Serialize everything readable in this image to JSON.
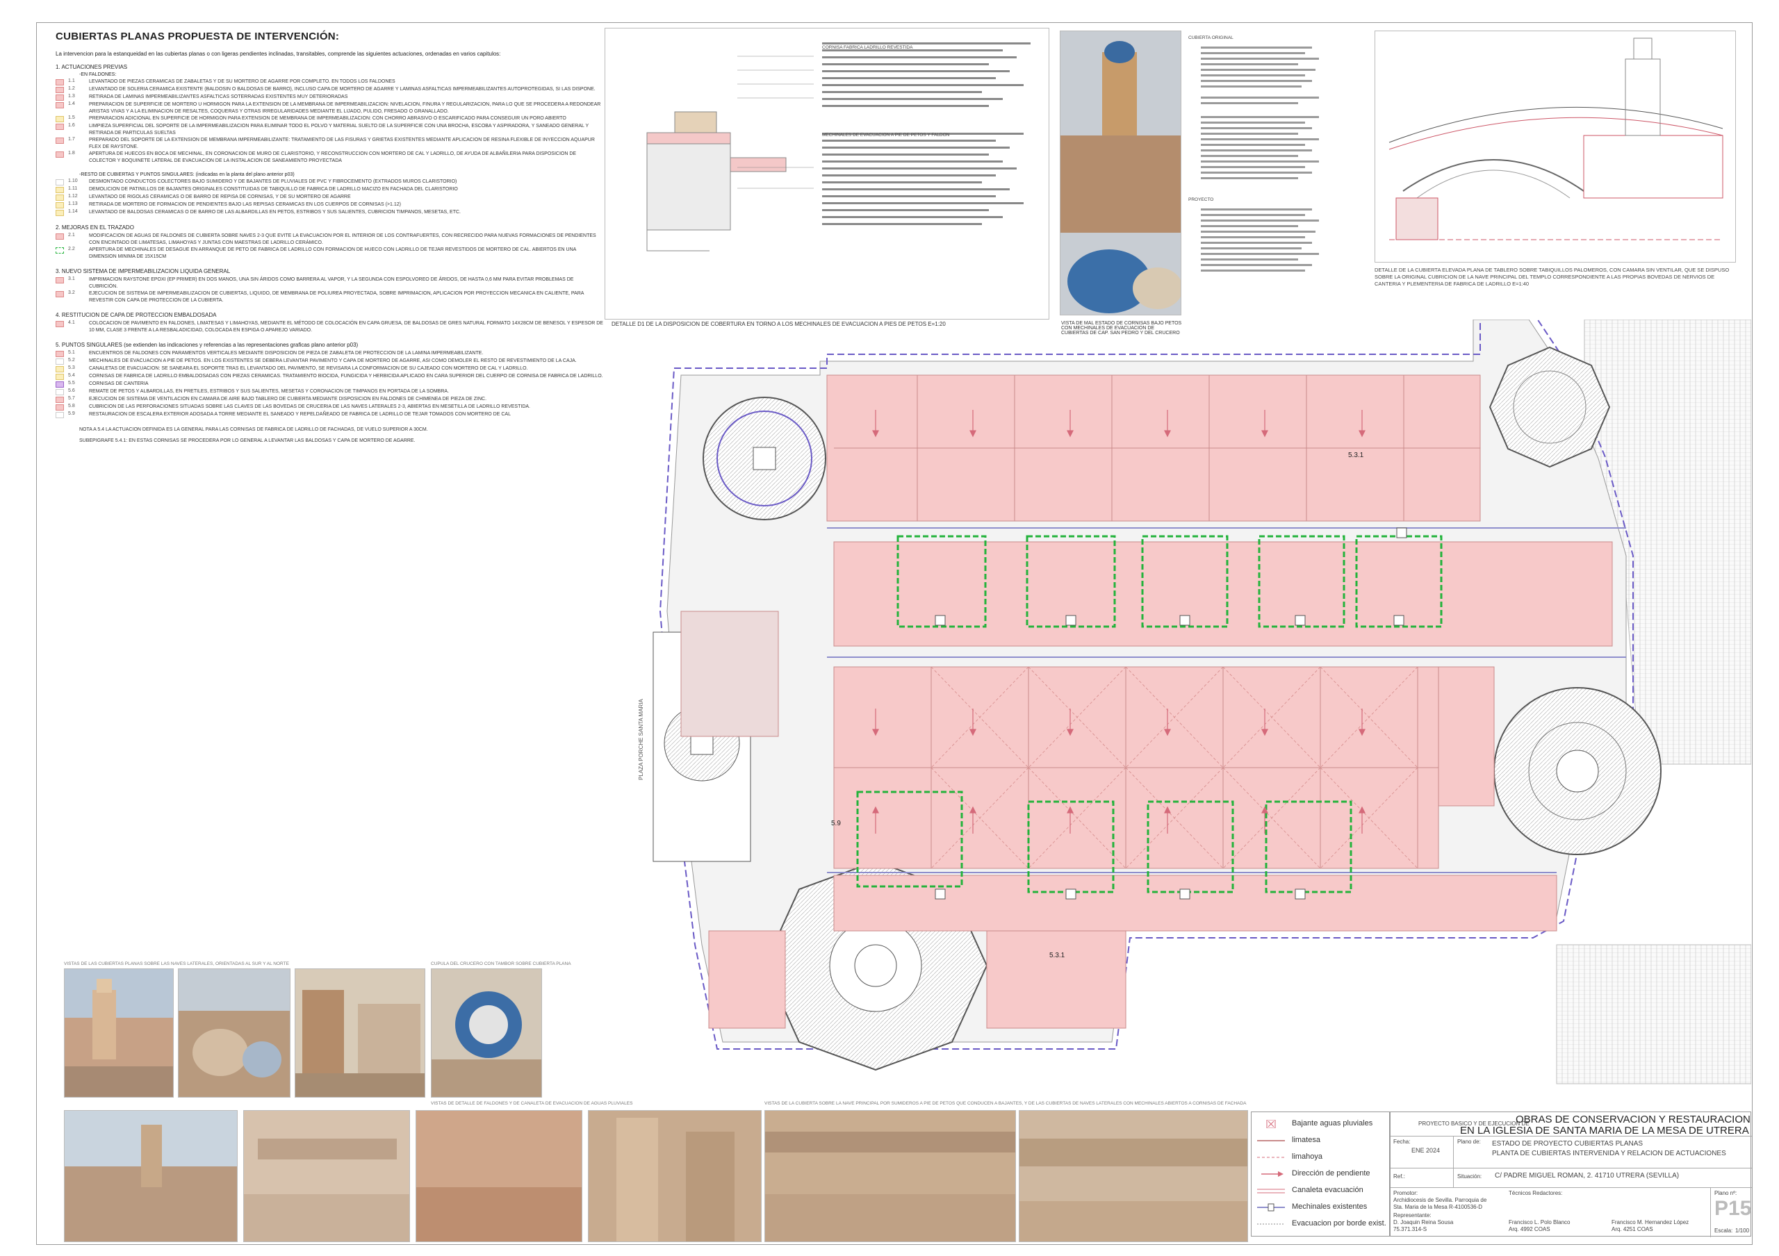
{
  "header": {
    "title": "CUBIERTAS PLANAS   PROPUESTA DE INTERVENCIÓN:",
    "intro": "La intervencion para la estanqueidad en las cubiertas planas o con ligeras pendientes inclinadas, transitables, comprende las siguientes actuaciones, ordenadas en varios capitulos:"
  },
  "sections": [
    {
      "heading": "1.    ACTUACIONES PREVIAS",
      "subheading": "-EN FALDONES:",
      "items": [
        {
          "code": "1.1",
          "swatch": "pink",
          "text": "LEVANTADO DE PIEZAS CERAMICAS DE ZABALETAS Y DE SU MORTERO DE AGARRE POR COMPLETO. EN TODOS LOS FALDONES"
        },
        {
          "code": "1.2",
          "swatch": "pink",
          "text": "LEVANTADO DE SOLERIA CERAMICA EXISTENTE (BALDOSIN O BALDOSAS DE BARRO), INCLUSO CAPA DE MORTERO DE AGARRE Y LAMINAS ASFALTICAS IMPERMEABILIZANTES AUTOPROTEGIDAS, SI LAS DISPONE."
        },
        {
          "code": "1.3",
          "swatch": "pink",
          "text": "RETIRADA DE LAMINAS IMPERMEABILIZANTES ASFALTICAS SOTERRADAS EXISTENTES MUY DETERIORADAS"
        },
        {
          "code": "1.4",
          "swatch": "pink",
          "text": "PREPARACION DE SUPERFICIE DE MORTERO U HORMIGON PARA LA EXTENSION DE LA MEMBRANA DE IMPERMEABILIZACION: NIVELACION, FINURA Y REGULARIZACION, PARA LO QUE SE PROCEDERA A REDONDEAR ARISTAS VIVAS Y A LA ELIMINACION DE RESALTES, COQUERAS Y OTRAS IRREGULARIDADES MEDIANTE EL LIJADO, PULIDO, FRESADO O GRANALLADO."
        },
        {
          "code": "1.5",
          "swatch": "yellow",
          "text": "PREPARACION ADICIONAL EN SUPERFICIE DE HORMIGON PARA EXTENSION DE MEMBRANA DE IMPERMEABILIZACION: CON CHORRO ABRASIVO O ESCARIFICADO PARA CONSEGUIR UN PORO ABIERTO"
        },
        {
          "code": "1.6",
          "swatch": "pink",
          "text": "LIMPIEZA SUPERFICIAL DEL SOPORTE DE LA IMPERMEABILIZACION PARA ELIMINAR TODO EL POLVO Y MATERIAL SUELTO DE LA SUPERFICIE CON UNA BROCHA, ESCOBA Y ASPIRADORA, Y SANEADO GENERAL Y RETIRADA DE PARTICULAS SUELTAS"
        },
        {
          "code": "1.7",
          "swatch": "pink",
          "text": "PREPARADO DEL SOPORTE DE LA EXTENSION DE MEMBRANA IMPERMEABILIZANTE: TRATAMIENTO DE LAS FISURAS Y GRIETAS EXISTENTES MEDIANTE APLICACION DE RESINA FLEXIBLE DE INYECCION AQUAPUR FLEX DE RAYSTONE."
        },
        {
          "code": "1.8",
          "swatch": "pink",
          "text": "APERTURA DE HUECOS EN BOCA DE MECHINAL, EN CORONACION DE MURO DE CLARISTORIO, Y RECONSTRUCCION CON MORTERO DE CAL Y LADRILLO, DE AYUDA DE ALBAÑILERIA PARA DISPOSICION DE COLECTOR Y BOQUINETE LATERAL DE EVACUACION DE LA INSTALACION DE SANEAMIENTO PROYECTADA"
        }
      ]
    },
    {
      "heading": "",
      "subheading": "-RESTO DE CUBIERTAS Y PUNTOS SINGULARES:  (indicadas en la planta del plano anterior p03)",
      "items": [
        {
          "code": "1.10",
          "swatch": "white",
          "text": "DESMONTADO CONDUCTOS COLECTORES BAJO SUMIDERO Y DE BAJANTES DE PLUVIALES DE PVC Y FIBROCEMENTO (EXTRADOS MUROS CLARISTORIO)"
        },
        {
          "code": "1.11",
          "swatch": "yellow",
          "text": "DEMOLICION DE PATINILLOS DE BAJANTES ORIGINALES CONSTITUIDAS DE TABIQUILLO DE FABRICA DE LADRILLO MACIZO EN FACHADA DEL CLARISTORIO"
        },
        {
          "code": "1.12",
          "swatch": "yellow",
          "text": "LEVANTADO DE RIGOLAS CERAMICAS O DE BARRO DE REPISA DE CORNISAS, Y DE SU MORTERO DE AGARRE"
        },
        {
          "code": "1.13",
          "swatch": "yellow",
          "text": "RETIRADA DE MORTERO DE FORMACION DE PENDIENTES BAJO LAS REPISAS CERAMICAS EN LOS CUERPOS DE CORNISAS (>1.12)"
        },
        {
          "code": "1.14",
          "swatch": "yellow",
          "text": "LEVANTADO DE BALDOSAS CERAMICAS O DE BARRO DE LAS ALBARDILLAS EN PETOS, ESTRIBOS Y SUS SALIENTES, CUBRICION TIMPANOS, MESETAS, ETC."
        }
      ]
    },
    {
      "heading": "2.    MEJORAS EN EL TRAZADO",
      "subheading": "",
      "items": [
        {
          "code": "2.1",
          "swatch": "pink",
          "text": "MODIFICACION DE AGUAS DE FALDONES DE CUBIERTA SOBRE NAVES 2-3 QUE EVITE LA EVACUACION POR EL INTERIOR DE LOS CONTRAFUERTES, CON RECRECIDO PARA NUEVAS FORMACIONES DE PENDIENTES CON ENCINTADO DE LIMATESAS, LIMAHOYAS Y JUNTAS CON MAESTRAS DE LADRILLO CERÁMICO."
        },
        {
          "code": "2.2",
          "swatch": "green",
          "text": "APERTURA DE MECHINALES DE DESAGUE EN ARRANQUE DE PETO DE FABRICA DE LADRILLO CON FORMACION DE HUECO CON LADRILLO DE TEJAR REVESTIDOS DE MORTERO DE CAL. ABIERTOS EN UNA DIMENSION MINIMA DE 15X15CM"
        }
      ]
    },
    {
      "heading": "3.    NUEVO SISTEMA DE IMPERMEABILIZACION LIQUIDA GENERAL",
      "subheading": "",
      "items": [
        {
          "code": "3.1",
          "swatch": "pink",
          "text": "IMPRIMACION RAYSTONE EPOXI (EP PRIMER) EN DOS MANOS, UNA SIN ÁRIDOS COMO BARRERA AL VAPOR, Y LA SEGUNDA CON ESPOLVOREO DE ÁRIDOS, DE HASTA 0,6 MM PARA EVITAR PROBLEMAS DE CUBRICIÓN."
        },
        {
          "code": "3.2",
          "swatch": "pink",
          "text": "EJECUCION DE SISTEMA DE IMPERMEABILIZACION DE CUBIERTAS, LIQUIDO, DE MEMBRANA DE POLIUREA PROYECTADA, SOBRE IMPRIMACION, APLICACION POR PROYECCION MECANICA EN CALIENTE, PARA REVESTIR CON CAPA DE PROTECCION DE LA CUBIERTA."
        }
      ]
    },
    {
      "heading": "4.    RESTITUCION DE CAPA DE PROTECCION EMBALDOSADA",
      "subheading": "",
      "items": [
        {
          "code": "4.1",
          "swatch": "pink",
          "text": "COLOCACION DE PAVIMENTO EN FALDONES, LIMATESAS Y LIMAHOYAS,  MEDIANTE EL MÉTODO DE COLOCACIÓN EN CAPA GRUESA, DE BALDOSAS DE GRES NATURAL FORMATO 14X28CM DE BENESOL Y ESPESOR DE 10 MM, CLASE 3 FRENTE A LA RESBALADICIDAD, COLOCADA EN ESPIGA O APAREJO VARIADO."
        }
      ]
    },
    {
      "heading": "5.    PUNTOS SINGULARES  (se extienden las indicaciones y referencias a las representaciones graficas plano anterior p03)",
      "subheading": "",
      "items": [
        {
          "code": "5.1",
          "swatch": "pink",
          "text": "ENCUENTROS DE FALDONES CON PARAMENTOS VERTICALES MEDIANTE DISPOSICION DE PIEZA DE ZABALETA DE  PROTECCION DE LA LAMINA IMPERMEABILIZANTE."
        },
        {
          "code": "5.2",
          "swatch": "white",
          "text": "MECHINALES DE EVACUACION A PIE DE PETOS. EN LOS EXISTENTES SE DEBERA LEVANTAR PAVIMENTO Y CAPA DE MORTERO DE AGARRE, ASI COMO DEMOLER EL RESTO DE REVESTIMIENTO DE LA CAJA."
        },
        {
          "code": "5.3",
          "swatch": "yellow",
          "text": "CANALETAS DE EVACUACION: SE SANEARA EL SOPORTE TRAS EL LEVANTADO DEL PAVIMENTO, SE REVISARA LA CONFORMACION DE SU CAJEADO CON MORTERO DE CAL Y LADRILLO."
        },
        {
          "code": "5.4",
          "swatch": "yellow",
          "text": "CORNISAS DE FABRICA DE LADRILLO EMBALDOSADAS CON PIEZAS CERAMICAS. TRATAMIENTO BIOCIDA, FUNGICIDA Y HERBICIDA APLICADO EN CARA SUPERIOR DEL CUERPO DE CORNISA DE FABRICA DE LADRILLO."
        },
        {
          "code": "5.5",
          "swatch": "purple",
          "text": "CORNISAS DE CANTERIA"
        },
        {
          "code": "5.6",
          "swatch": "white",
          "text": "REMATE DE PETOS Y ALBARDILLAS, EN PRETILES, ESTRIBOS Y SUS SALIENTES, MESETAS Y CORONACION DE TIMPANOS EN PORTADA DE LA SOMBRA."
        },
        {
          "code": "5.7",
          "swatch": "pink",
          "text": "EJECUCION DE SISTEMA DE VENTILACION EN CAMARA DE AIRE BAJO TABLERO DE CUBIERTA MEDIANTE DISPOSICION EN FALDONES DE CHIMENEA DE PIEZA DE ZINC."
        },
        {
          "code": "5.8",
          "swatch": "pink",
          "text": "CUBRICION DE LAS PERFORACIONES SITUADAS SOBRE LAS CLAVES DE LAS BOVEDAS DE CRUCERIA DE LAS NAVES LATERALES 2-3, ABIERTAS EN MESETILLA DE LADRILLO REVESTIDA."
        },
        {
          "code": "5.9",
          "swatch": "white",
          "text": "RESTAURACION DE ESCALERA EXTERIOR ADOSADA A TORRE MEDIANTE EL SANEADO Y REPELDAÑEADO DE FABRICA DE LADRILLO DE TEJAR TOMADOS CON MORTERO DE CAL"
        }
      ]
    }
  ],
  "notes": {
    "note_5_4": "NOTA A 5.4  LA ACTUACION DEFINIDA ES LA GENERAL PARA LAS CORNISAS DE FABRICA DE LADRILLO DE FACHADAS, DE VUELO SUPERIOR A 30CM.",
    "subepigrafe": "SUBEPIGRAFE 5.4.1: EN ESTAS CORNISAS SE PROCEDERA POR LO GENERAL A LEVANTAR LAS BALDOSAS Y CAPA DE MORTERO DE AGARRE."
  },
  "photo_captions": {
    "lateral": "VISTAS DE LAS CUBIERTAS PLANAS SOBRE LAS NAVES LATERALES, ORIENTADAS AL SUR Y AL NORTE",
    "cupula": "CUPULA DEL CRUCERO CON TAMBOR SOBRE CUBIERTA PLANA",
    "faldones": "VISTAS DE DETALLE DE FALDONES Y DE CANALETA DE EVACUACION DE AGUAS PLUVIALES",
    "nave": "VISTAS DE LA CUBIERTA SOBRE LA NAVE PRINCIPAL POR SUMIDEROS A PIE DE PETOS QUE CONDUCEN A BAJANTES, Y DE LAS CUBIERTAS DE NAVES LATERALES CON MECHINALES ABIERTOS A CORNISAS DE FACHADA"
  },
  "details": {
    "d1_caption": "DETALLE D1   DE LA DISPOSICION DE COBERTURA EN TORNO A LOS MECHINALES DE EVACUACION A PIES DE PETOS      E=1:20",
    "d1_title": "CORNISA FABRICA LADRILLO REVESTIDA",
    "d1_sub": "MECHINALES DE EVACUACION A PIE DE PETOS Y FALDON",
    "photo_caption": "VISTA DE MAL ESTADO DE CORNISAS BAJO PETOS CON MECHINALES DE EVACUACION DE CUBIERTAS DE CAP. SAN PEDRO Y DEL CRUCERO",
    "right_title": "CUBIERTA ORIGINAL",
    "right_sub": "PROYECTO",
    "right_caption": "DETALLE DE LA CUBIERTA ELEVADA PLANA DE TABLERO SOBRE TABIQUILLOS PALOMEROS, CON CAMARA SIN VENTILAR, QUE SE DISPUSO SOBRE LA ORIGINAL CUBRICION DE LA NAVE PRINCIPAL DEL TEMPLO CORRESPONDIENTE A LAS PROPIAS BOVEDAS DE NERVIOS DE CANTERIA Y PLEMENTERIA DE FABRICA DE LADRILLO     E=1:40"
  },
  "plan": {
    "labels": {
      "l531a": "5.3.1",
      "l531b": "5.3.1",
      "l59": "5.9",
      "plaza": "PLAZA  PORCHE  SANTA  MARIA"
    }
  },
  "legend": {
    "items": [
      {
        "label": "Bajante aguas pluviales",
        "icon": "downpipe-icon"
      },
      {
        "label": "limatesa",
        "icon": "ridge-line-icon"
      },
      {
        "label": "limahoya",
        "icon": "valley-line-icon"
      },
      {
        "label": "Dirección de pendiente",
        "icon": "slope-arrow-icon"
      },
      {
        "label": "Canaleta evacuación",
        "icon": "gutter-icon"
      },
      {
        "label": "Mechinales existentes",
        "icon": "drain-hole-icon"
      },
      {
        "label": "Evacuacion por borde exist.",
        "icon": "edge-drain-icon"
      }
    ]
  },
  "title_block": {
    "project_prefix": "PROYECTO BASICO Y DE EJECUCION DE",
    "project_title_1": "OBRAS DE CONSERVACION Y RESTAURACION",
    "project_title_2": "EN LA IGLESIA DE SANTA MARIA DE LA MESA DE UTRERA",
    "fecha_label": "Fecha:",
    "fecha": "ENE 2024",
    "plano_label": "Plano de:",
    "plano_1": "ESTADO DE PROYECTO    CUBIERTAS PLANAS",
    "plano_2": "PLANTA DE CUBIERTAS INTERVENIDA Y RELACION DE ACTUACIONES",
    "ref_label": "Ref.:",
    "situacion_label": "Situación:",
    "situacion": "C/ PADRE MIGUEL ROMAN, 2.  41710 UTRERA (SEVILLA)",
    "promotor_label": "Promotor:",
    "promotor_1": "Archidiocesis de Sevilla. Parroquia de",
    "promotor_2": "Sta. Maria de la Mesa  R-4100536-D",
    "representante_label": "Representante:",
    "representante_1": "D. Joaquin Reina Sousa",
    "representante_2": "75.371.314-S",
    "tecnicos_label": "Técnicos Redactores:",
    "tecnico1_name": "Francisco L. Polo Blanco",
    "tecnico1_num": "Arq. 4992 COAS",
    "tecnico2_name": "Francisco M. Hernandez López",
    "tecnico2_num": "Arq. 4251 COAS",
    "plano_n_label": "Plano nº:",
    "plano_n": "P15",
    "escala_label": "Escala:",
    "escala": "1/100"
  }
}
